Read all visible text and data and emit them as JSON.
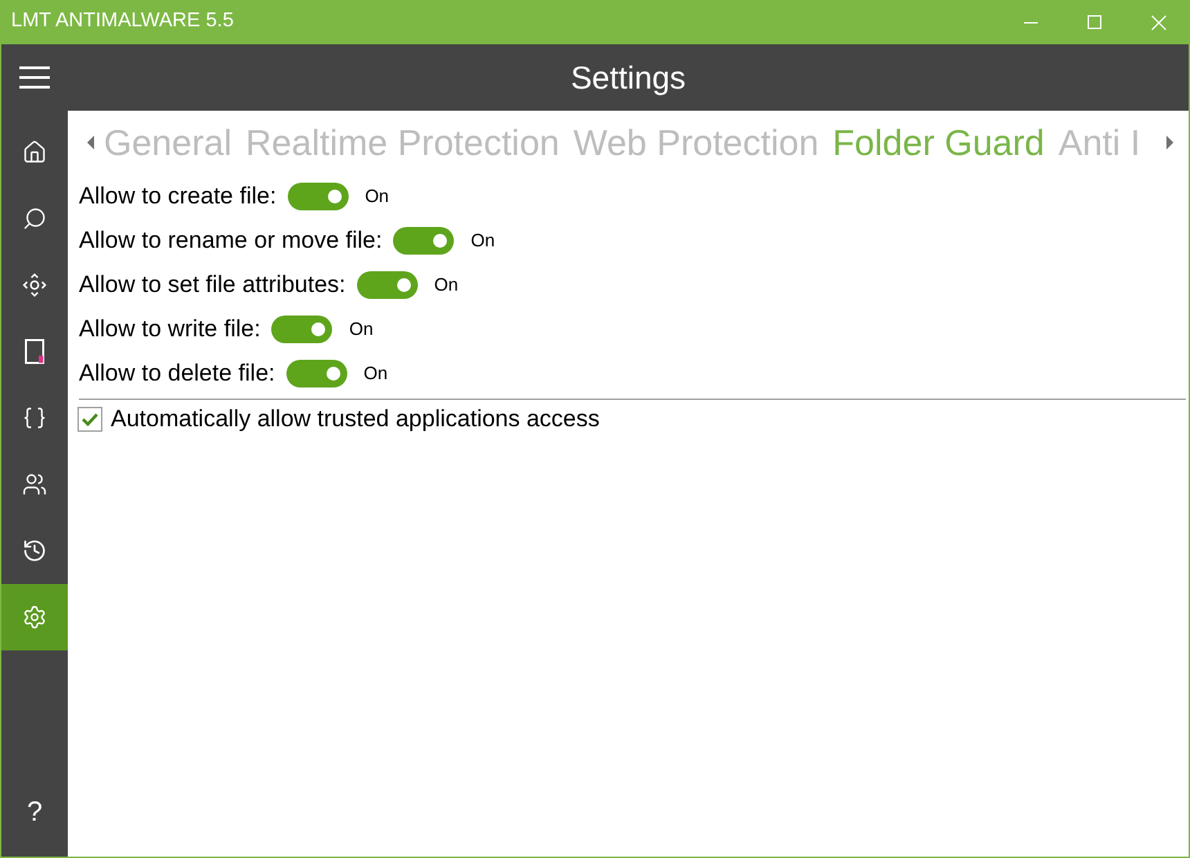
{
  "window": {
    "title": "LMT ANTIMALWARE 5.5"
  },
  "header": {
    "title": "Settings"
  },
  "sidebar": {
    "items": [
      {
        "selected": false
      },
      {
        "selected": false
      },
      {
        "selected": false
      },
      {
        "selected": false
      },
      {
        "selected": false
      },
      {
        "selected": false
      },
      {
        "selected": false
      },
      {
        "selected": true
      }
    ],
    "help_label": "?"
  },
  "tabs": [
    {
      "label": "General",
      "selected": false
    },
    {
      "label": "Realtime Protection",
      "selected": false
    },
    {
      "label": "Web Protection",
      "selected": false
    },
    {
      "label": "Folder Guard",
      "selected": true
    },
    {
      "label": "Anti I",
      "selected": false
    }
  ],
  "toggles": [
    {
      "label": "Allow to create file:",
      "on": true,
      "state_text": "On"
    },
    {
      "label": "Allow to rename or move file:",
      "on": true,
      "state_text": "On"
    },
    {
      "label": "Allow to set file attributes:",
      "on": true,
      "state_text": "On"
    },
    {
      "label": "Allow to write file:",
      "on": true,
      "state_text": "On"
    },
    {
      "label": "Allow to delete file:",
      "on": true,
      "state_text": "On"
    }
  ],
  "trusted_access": {
    "label": "Automatically allow trusted applications access",
    "checked": true
  }
}
